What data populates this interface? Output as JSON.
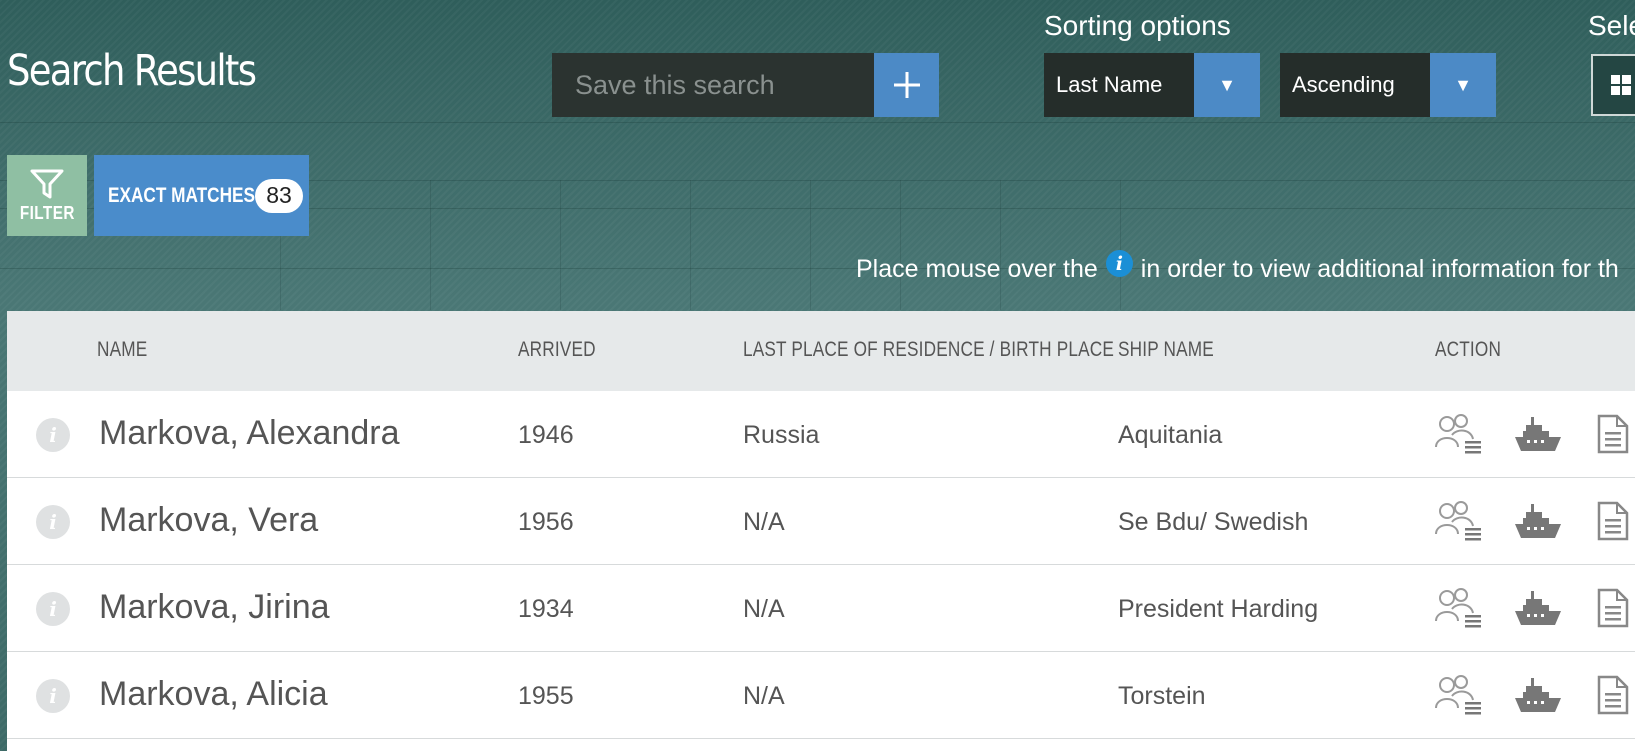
{
  "page": {
    "title": "Search Results"
  },
  "save_search": {
    "placeholder": "Save this search",
    "add_icon": "plus-icon"
  },
  "sorting": {
    "label": "Sorting options",
    "field": "Last Name",
    "order": "Ascending"
  },
  "select_label": "Sele",
  "filter": {
    "label": "FILTER",
    "icon": "filter-icon"
  },
  "exact_matches": {
    "label": "EXACT MATCHES",
    "count": "83"
  },
  "hint": {
    "before": "Place mouse over the",
    "icon_glyph": "i",
    "after": "in order to view additional information for th"
  },
  "table": {
    "columns": {
      "name": "NAME",
      "arrived": "ARRIVED",
      "residence": "LAST PLACE OF RESIDENCE / BIRTH PLACE",
      "ship": "SHIP NAME",
      "action": "ACTION"
    },
    "rows": [
      {
        "name": "Markova, Alexandra",
        "arrived": "1946",
        "residence": "Russia",
        "ship": "Aquitania"
      },
      {
        "name": "Markova, Vera",
        "arrived": "1956",
        "residence": "N/A",
        "ship": "Se Bdu/ Swedish"
      },
      {
        "name": "Markova, Jirina",
        "arrived": "1934",
        "residence": "N/A",
        "ship": "President Harding"
      },
      {
        "name": "Markova, Alicia",
        "arrived": "1955",
        "residence": "N/A",
        "ship": "Torstein"
      }
    ],
    "info_glyph": "i",
    "action_icons": [
      "passengers-list-icon",
      "ship-icon",
      "document-icon"
    ]
  },
  "colors": {
    "accent_blue": "#4c8ac6",
    "filter_green": "#8fbfa3",
    "dark_field": "#252d2a",
    "info_blue": "#1b8fd6"
  }
}
